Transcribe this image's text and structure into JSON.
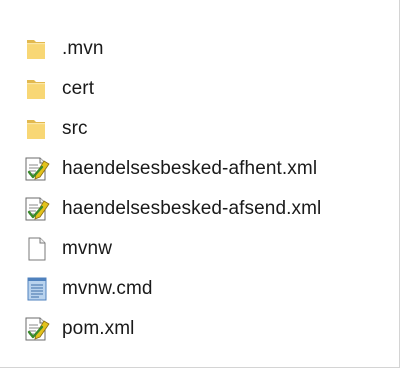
{
  "files": [
    {
      "name": ".mvn",
      "icon": "folder-icon"
    },
    {
      "name": "cert",
      "icon": "folder-icon"
    },
    {
      "name": "src",
      "icon": "folder-icon"
    },
    {
      "name": "haendelsesbesked-afhent.xml",
      "icon": "xml-file-icon"
    },
    {
      "name": "haendelsesbesked-afsend.xml",
      "icon": "xml-file-icon"
    },
    {
      "name": "mvnw",
      "icon": "blank-file-icon"
    },
    {
      "name": "mvnw.cmd",
      "icon": "cmd-file-icon"
    },
    {
      "name": "pom.xml",
      "icon": "xml-file-icon"
    }
  ],
  "colors": {
    "folder": "#f8d775",
    "folder_edge": "#e2b94f",
    "xml_pencil": "#e3c21b",
    "xml_check": "#3a8b2d",
    "cmd_fill": "#b9d3ee",
    "cmd_edge": "#4f81bd"
  }
}
